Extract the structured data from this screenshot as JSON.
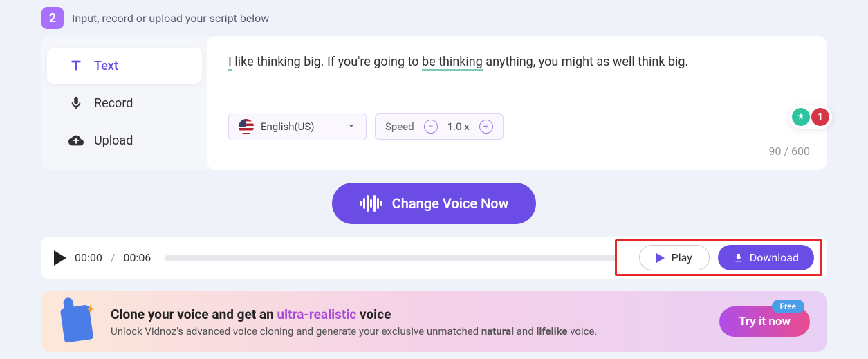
{
  "step": {
    "number": "2",
    "title": "Input, record or upload your script below"
  },
  "tabs": [
    {
      "label": "Text",
      "icon": "text-icon"
    },
    {
      "label": "Record",
      "icon": "mic-icon"
    },
    {
      "label": "Upload",
      "icon": "cloud-icon"
    }
  ],
  "script": {
    "parts": [
      {
        "text": "I",
        "underline": true
      },
      {
        "text": " like thinking big. If you're going to ",
        "underline": false
      },
      {
        "text": "be thinking",
        "underline": true
      },
      {
        "text": " anything, you might as well think big.",
        "underline": false
      }
    ]
  },
  "language": {
    "label": "English(US)"
  },
  "speed": {
    "label": "Speed",
    "value": "1.0 x"
  },
  "counter": {
    "current": "90",
    "max": "600"
  },
  "badge": {
    "count": "1"
  },
  "cta": {
    "label": "Change Voice Now"
  },
  "player": {
    "current": "00:00",
    "total": "00:06",
    "play_label": "Play",
    "download_label": "Download"
  },
  "promo": {
    "title_pre": "Clone your voice and get an ",
    "title_highlight": "ultra-realistic",
    "title_post": " voice",
    "sub_pre": "Unlock Vidnoz's advanced voice cloning and generate your exclusive unmatched ",
    "sub_bold1": "natural",
    "sub_mid": " and ",
    "sub_bold2": "lifelike",
    "sub_post": " voice.",
    "button": "Try it now",
    "tag": "Free"
  }
}
